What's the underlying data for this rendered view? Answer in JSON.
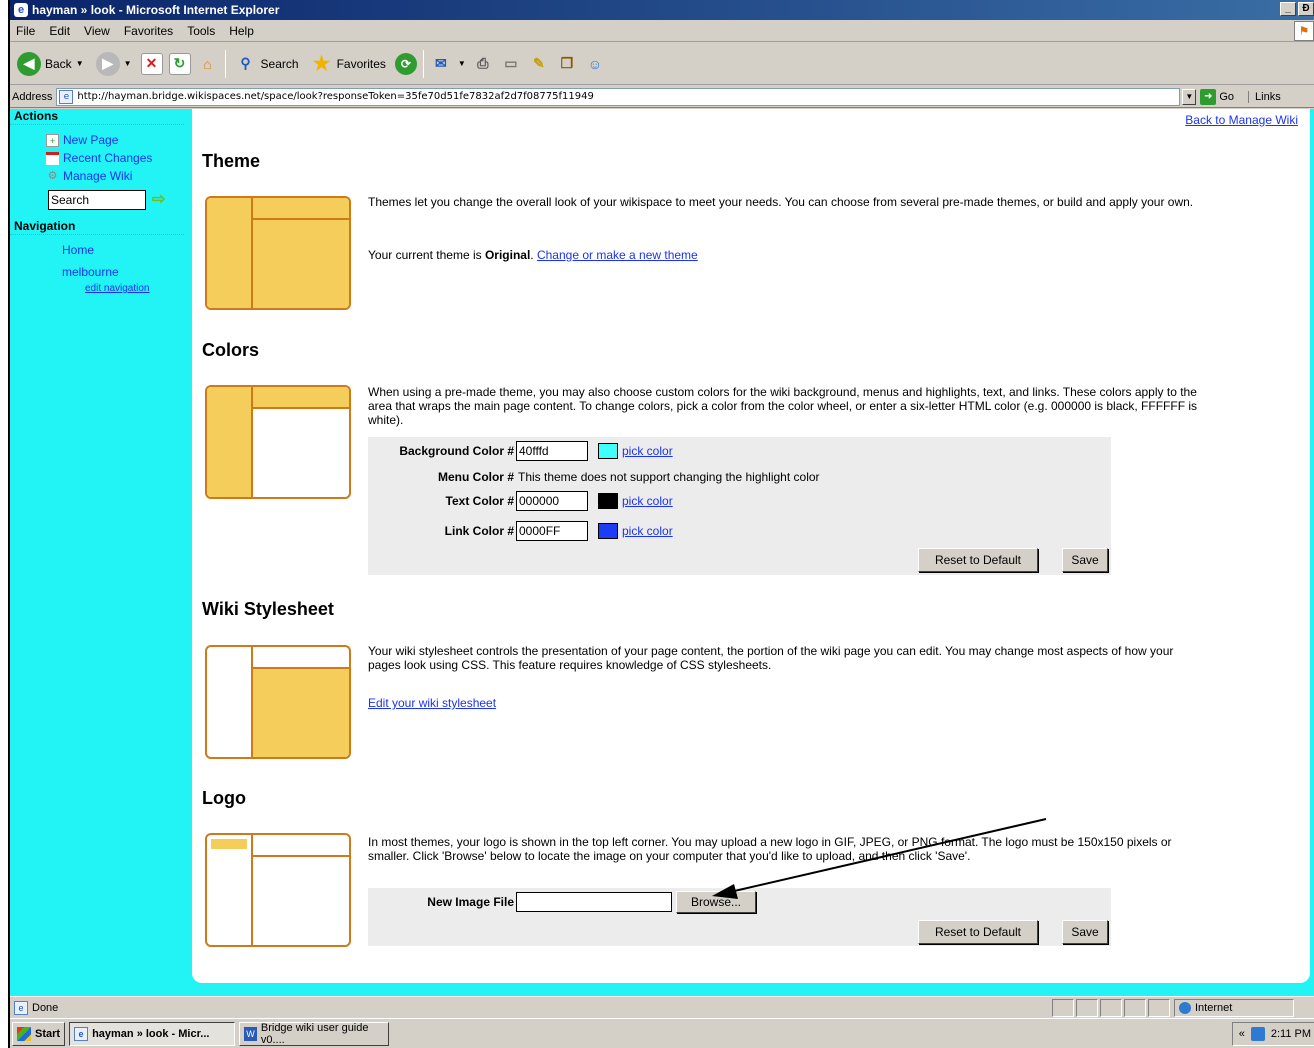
{
  "window": {
    "title": "hayman » look - Microsoft Internet Explorer",
    "buttons": [
      "_",
      "Ɖ",
      "x"
    ]
  },
  "menu": [
    "File",
    "Edit",
    "View",
    "Favorites",
    "Tools",
    "Help"
  ],
  "toolbar": {
    "back": "Back",
    "search": "Search",
    "favorites": "Favorites"
  },
  "address": {
    "label": "Address",
    "url": "http://hayman.bridge.wikispaces.net/space/look?responseToken=35fe70d51fe7832af2d7f08775f11949",
    "go": "Go",
    "links": "Links"
  },
  "sidebar": {
    "actions_title": "Actions",
    "actions": [
      {
        "label": "New Page",
        "icon": "new-page-icon"
      },
      {
        "label": "Recent Changes",
        "icon": "calendar-icon"
      },
      {
        "label": "Manage Wiki",
        "icon": "gear-icon"
      }
    ],
    "search_value": "Search",
    "navigation_title": "Navigation",
    "nav": [
      "Home",
      "melbourne"
    ],
    "edit_navigation": "edit navigation"
  },
  "main": {
    "back_link": "Back to Manage Wiki",
    "theme": {
      "title": "Theme",
      "desc": "Themes let you change the overall look of your wikispace to meet your needs. You can choose from several pre-made themes, or build and apply your own.",
      "current_prefix": "Your current theme is ",
      "current_name": "Original",
      "current_suffix": ". ",
      "change_link": "Change or make a new theme"
    },
    "colors": {
      "title": "Colors",
      "desc": "When using a pre-made theme, you may also choose custom colors for the wiki background, menus and highlights, text, and links. These colors apply to the area that wraps the main page content. To change colors, pick a color from the color wheel, or enter a six-letter HTML color (e.g. 000000 is black, FFFFFF is white).",
      "background_label": "Background Color #",
      "background_value": "40fffd",
      "background_swatch": "#40fffd",
      "menu_label": "Menu Color #",
      "menu_note": "This theme does not support changing the highlight color",
      "text_label": "Text Color #",
      "text_value": "000000",
      "text_swatch": "#000000",
      "link_label": "Link Color #",
      "link_value": "0000FF",
      "link_swatch": "#1d3cf5",
      "pick": "pick color",
      "reset": "Reset to Default",
      "save": "Save"
    },
    "stylesheet": {
      "title": "Wiki Stylesheet",
      "desc": "Your wiki stylesheet controls the presentation of your page content, the portion of the wiki page you can edit. You may change most aspects of how your pages look using CSS. This feature requires knowledge of CSS stylesheets.",
      "edit_link": "Edit your wiki stylesheet"
    },
    "logo": {
      "title": "Logo",
      "desc": "In most themes, your logo is shown in the top left corner. You may upload a new logo in GIF, JPEG, or PNG format. The logo must be 150x150 pixels or smaller. Click 'Browse' below to locate the image on your computer that you'd like to upload, and then click 'Save'.",
      "file_label": "New Image File",
      "browse": "Browse...",
      "reset": "Reset to Default",
      "save": "Save"
    }
  },
  "status": {
    "text": "Done",
    "zone": "Internet"
  },
  "taskbar": {
    "start": "Start",
    "items": [
      "hayman » look - Micr...",
      "Bridge wiki user guide v0...."
    ],
    "clock": "2:11 PM",
    "tray_chevron": "«"
  },
  "colors": {
    "page_background": "#22f4f6",
    "link": "#1b33f2",
    "theme_icon_fill": "#f5cd5b",
    "theme_icon_border": "#cf7a1a"
  }
}
